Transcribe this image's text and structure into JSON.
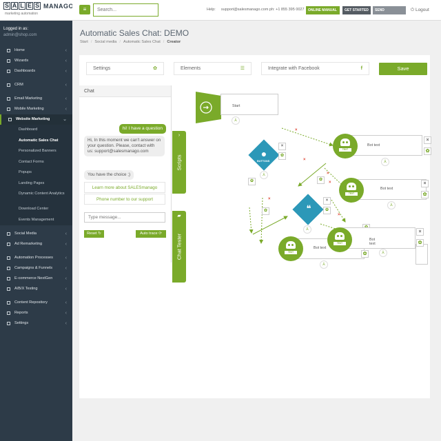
{
  "brand": {
    "box_letters": [
      "S",
      "A",
      "L",
      "E",
      "S"
    ],
    "word": "MANAGO",
    "tagline": "marketing automation"
  },
  "sidebar": {
    "logged_label": "Logged in as:",
    "logged_user": "admin@shop.com",
    "items": [
      {
        "label": "Home",
        "gap": false
      },
      {
        "label": "Wizards",
        "gap": false
      },
      {
        "label": "Dashboards",
        "gap": false
      },
      {
        "label": "CRM",
        "gap": true
      },
      {
        "label": "Email Marketing",
        "gap": true
      },
      {
        "label": "Mobile Marketing",
        "gap": false
      },
      {
        "label": "Website Marketing",
        "gap": false,
        "active": true
      }
    ],
    "subitems": [
      "Dashboard",
      "Automatic Sales Chat",
      "Personalized Banners",
      "Contact Forms",
      "Popups",
      "Landing Pages",
      "Dynamic Content Analytics",
      "Download Center",
      "Events Management"
    ],
    "active_sub": "Automatic Sales Chat",
    "items2": [
      {
        "label": "Social Media",
        "gap": true
      },
      {
        "label": "Ad Remarketing",
        "gap": false
      },
      {
        "label": "Automation Processes",
        "gap": true
      },
      {
        "label": "Campaigns & Funnels",
        "gap": false
      },
      {
        "label": "E-commerce NextGen",
        "gap": false
      },
      {
        "label": "A/B/X Testing",
        "gap": false
      },
      {
        "label": "Content Repository",
        "gap": true
      },
      {
        "label": "Reports",
        "gap": false
      },
      {
        "label": "Settings",
        "gap": false
      }
    ]
  },
  "topbar": {
    "search_placeholder": "Search...",
    "help_label": "Help:",
    "help_text": "support@salesmanago.com ph: +1 855 395 0027",
    "online_manual": "ONLINE MANUAL",
    "get_started": "GET STARTED",
    "send_feedback": "SEND FEEDBACK",
    "logout": "Logout"
  },
  "page": {
    "title": "Automatic Sales Chat: DEMO",
    "breadcrumb": [
      "Start",
      "Social media",
      "Automatic Sales Chat",
      "Creator"
    ]
  },
  "toolbar": {
    "settings": "Settings",
    "elements": "Elements",
    "facebook": "Integrate with Facebook",
    "save": "Save"
  },
  "chat": {
    "header": "Chat",
    "user_msg": "hi! I have a question",
    "bot_msg": "Hi, In this moment we can't answer on your question. Please, contact with us: support@salesmanago.com",
    "bot_msg2": "You have the choice ;)",
    "options": [
      "Learn more about SALESmanago",
      "Phone number to our support"
    ],
    "input_placeholder": "Type message...",
    "reset": "Reset",
    "auto_trace": "Auto trace"
  },
  "tabs": {
    "scripts": "Scripts",
    "chat_tester": "Chat Tester"
  },
  "canvas": {
    "start_label": "Start",
    "bot_label": "Bot text",
    "bot_caption": "TEXT",
    "buttons_caption": "BUTTONS",
    "accent": "#7aaa2a",
    "diamond_color": "#2c98b8",
    "x_color": "#e04a3a"
  }
}
